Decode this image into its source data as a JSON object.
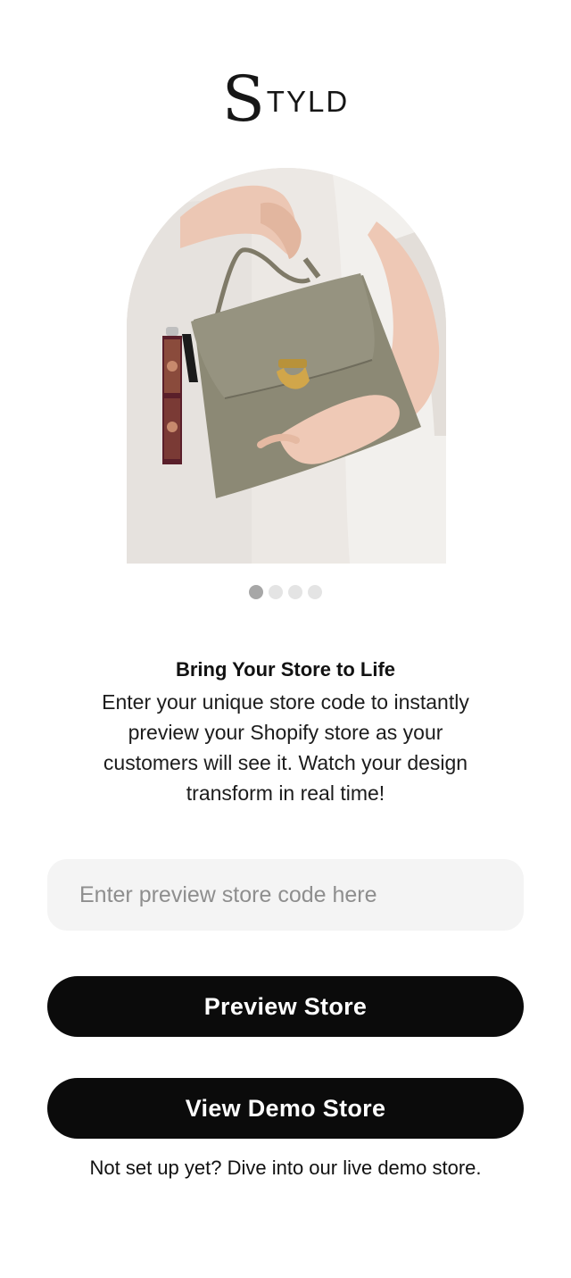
{
  "logo": {
    "initial": "S",
    "rest": "TYLD"
  },
  "hero": {
    "image_alt": "Woman holding olive-grey handbag with photo keychain",
    "carousel": {
      "total_slides": 4,
      "active_index": 0
    }
  },
  "content": {
    "headline": "Bring Your Store to Life",
    "description": "Enter your unique store code to instantly preview your Shopify store as your customers will see it. Watch your design transform in real time!"
  },
  "form": {
    "code_input": {
      "value": "",
      "placeholder": "Enter preview store code here"
    },
    "preview_button_label": "Preview Store",
    "demo_button_label": "View Demo Store",
    "footnote": "Not set up yet? Dive into our live demo store."
  },
  "colors": {
    "primary_button": "#0b0b0b",
    "input_background": "#f4f4f4",
    "dot_active": "#a7a7a7",
    "dot_inactive": "#e4e4e4"
  }
}
